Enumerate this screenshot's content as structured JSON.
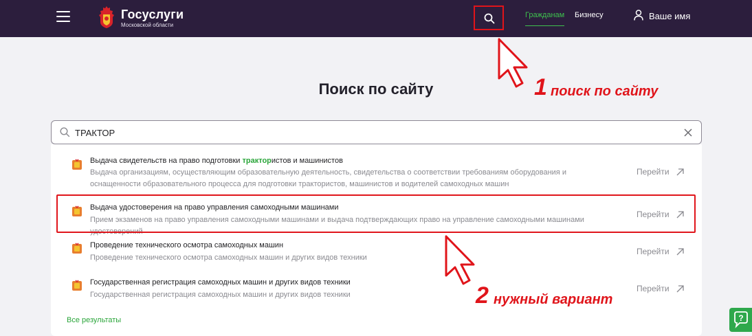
{
  "header": {
    "logo_title": "Госуслуги",
    "logo_subtitle": "Московской области",
    "nav_citizens": "Гражданам",
    "nav_business": "Бизнесу",
    "user_label": "Ваше имя",
    "accent_color": "#3ec14e",
    "bg_color": "#2c1e3d"
  },
  "page_title": "Поиск по сайту",
  "search": {
    "value": "ТРАКТОР"
  },
  "results": [
    {
      "title_before": "Выдача свидетельств на право подготовки ",
      "title_highlight": "трактор",
      "title_after": "истов и машинистов",
      "description": "Выдача организациям, осуществляющим образовательную деятельность, свидетельства о соответствии требованиям оборудования и оснащенности образовательного процесса для подготовки трактористов, машинистов и водителей самоходных машин",
      "action": "Перейти"
    },
    {
      "title": "Выдача удостоверения на право управления самоходными машинами",
      "description": "Прием экзаменов на право управления самоходными машинами и выдача подтверждающих право на управление самоходными машинами удостоверений",
      "action": "Перейти"
    },
    {
      "title": "Проведение технического осмотра самоходных машин",
      "description": "Проведение технического осмотра самоходных машин и других видов техники",
      "action": "Перейти"
    },
    {
      "title": "Государственная регистрация самоходных машин и других видов техники",
      "description": "Государственная регистрация самоходных машин и других видов техники",
      "action": "Перейти"
    }
  ],
  "all_results": "Все результаты",
  "annotations": {
    "one_num": "1",
    "one_text": "поиск по сайту",
    "two_num": "2",
    "two_text": "нужный вариант",
    "color": "#e0141a"
  },
  "icons": [
    "menu-icon",
    "coat-of-arms-icon",
    "search-icon",
    "user-icon",
    "clear-icon",
    "service-icon",
    "external-link-icon",
    "chat-icon"
  ]
}
